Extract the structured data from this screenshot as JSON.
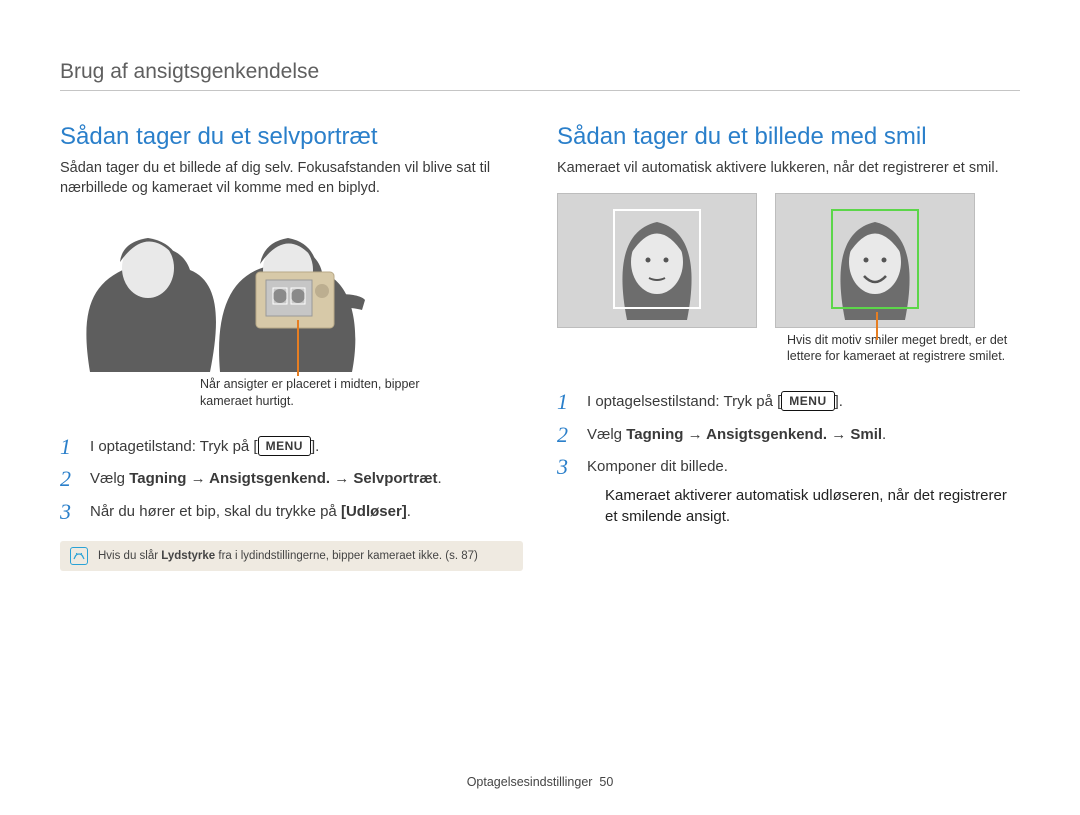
{
  "page_heading": "Brug af ansigtsgenkendelse",
  "footer": {
    "label": "Optagelsesindstillinger",
    "page": "50"
  },
  "left": {
    "title": "Sådan tager du et selvportræt",
    "intro": "Sådan tager du et billede af dig selv. Fokusafstanden vil blive sat til nærbillede og kameraet vil komme med en biplyd.",
    "caption": "Når ansigter er placeret i midten, bipper kameraet hurtigt.",
    "steps": {
      "s1_pre": "I optagetilstand: Tryk på [",
      "s1_btn": "MENU",
      "s1_post": "].",
      "s2_pre": "Vælg ",
      "s2_bold": "Tagning → Ansigtsgenkend. → Selvportræt",
      "s2_post": ".",
      "s3_pre": "Når du hører et bip, skal du trykke på ",
      "s3_bold": "[Udløser]",
      "s3_post": "."
    },
    "note_pre": "Hvis du slår ",
    "note_bold": "Lydstyrke",
    "note_post": " fra i lydindstillingerne, bipper kameraet ikke. (s. 87)"
  },
  "right": {
    "title": "Sådan tager du et billede med smil",
    "intro": "Kameraet vil automatisk aktivere lukkeren, når det registrerer et smil.",
    "caption": "Hvis dit motiv smiler meget bredt, er det lettere for kameraet at registrere smilet.",
    "steps": {
      "s1_pre": "I optagelsestilstand: Tryk på [",
      "s1_btn": "MENU",
      "s1_post": "].",
      "s2_pre": "Vælg ",
      "s2_bold": "Tagning → Ansigtsgenkend. → Smil",
      "s2_post": ".",
      "s3": "Komponer dit billede.",
      "s3_sub": "Kameraet aktiverer automatisk udløseren, når det registrerer et smilende ansigt."
    }
  }
}
